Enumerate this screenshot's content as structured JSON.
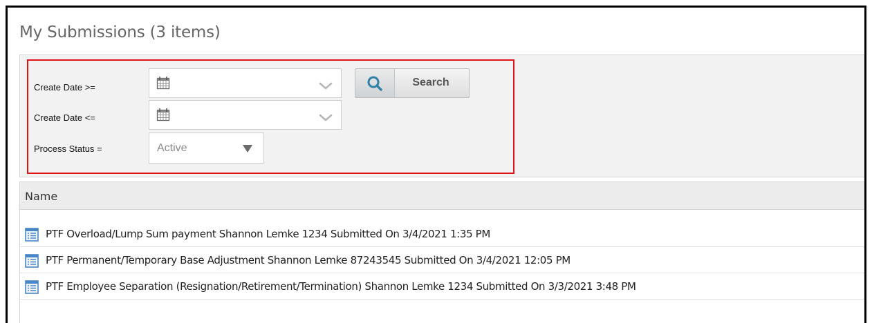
{
  "page": {
    "title": "My Submissions (3 items)"
  },
  "filters": {
    "create_date_from_label": "Create Date >=",
    "create_date_to_label": "Create Date <=",
    "process_status_label": "Process Status =",
    "process_status_value": "Active",
    "search_label": "Search",
    "highlight_color": "#e0131b"
  },
  "icons": {
    "calendar": "calendar-icon",
    "dropdown": "chevron-down-icon",
    "select_arrow": "triangle-down-icon",
    "search": "search-icon",
    "document": "document-list-icon"
  },
  "grid": {
    "column_header": "Name",
    "rows": [
      "PTF Overload/Lump Sum payment Shannon Lemke 1234 Submitted On 3/4/2021 1:35 PM",
      "PTF Permanent/Temporary Base Adjustment Shannon Lemke 87243545 Submitted On 3/4/2021 12:05 PM",
      "PTF Employee Separation (Resignation/Retirement/Termination) Shannon Lemke 1234 Submitted On 3/3/2021 3:48 PM"
    ]
  }
}
